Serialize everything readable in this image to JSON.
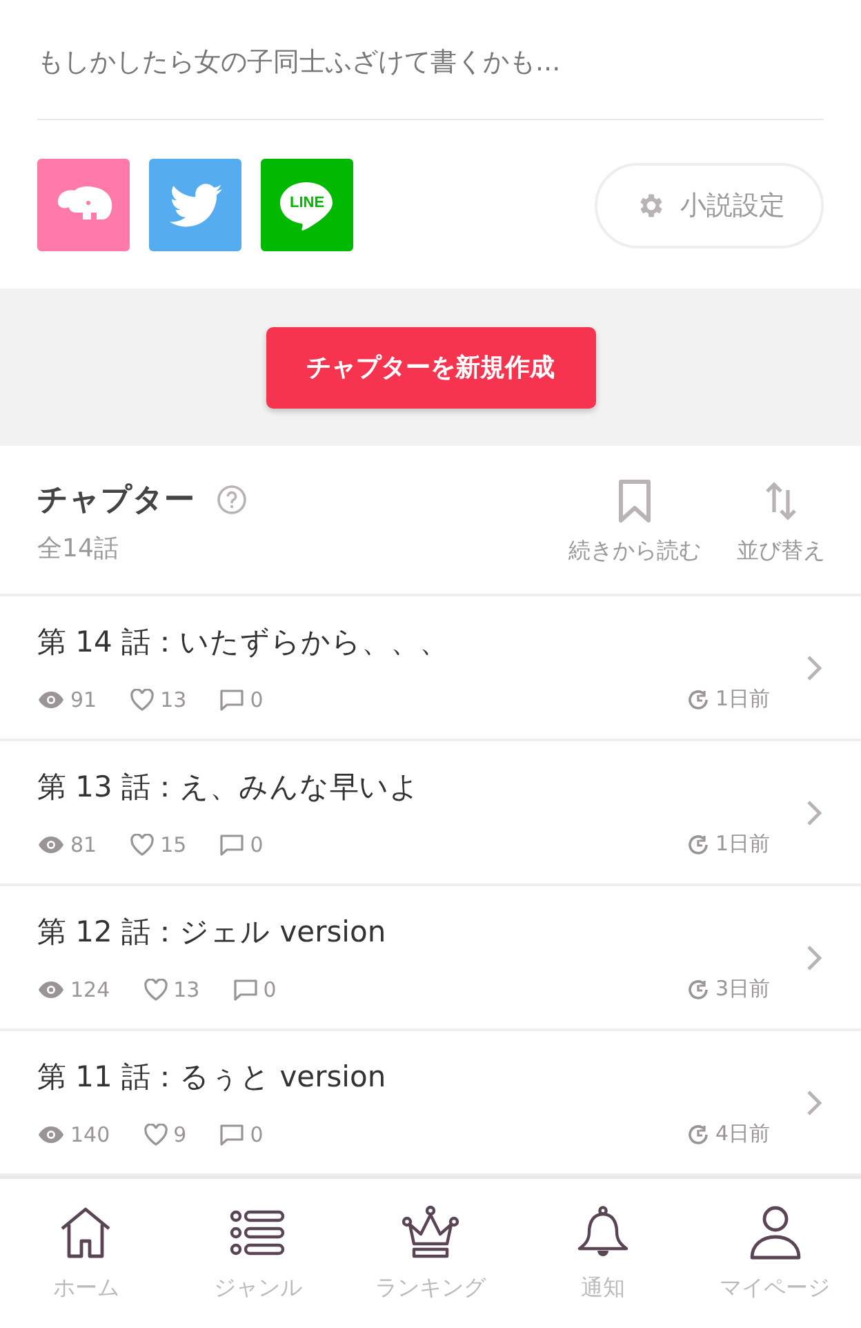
{
  "description": "もしかしたら女の子同士ふざけて書くかも...",
  "share_buttons": [
    {
      "kind": "elephant"
    },
    {
      "kind": "twitter"
    },
    {
      "kind": "line",
      "label": "LINE"
    }
  ],
  "settings_button": {
    "label": "小説設定"
  },
  "create_button": {
    "label": "チャプターを新規作成"
  },
  "chapters_header": {
    "title": "チャプター",
    "count": "全14話",
    "actions": [
      {
        "kind": "bookmark",
        "label": "続きから読む"
      },
      {
        "kind": "sort",
        "label": "並び替え"
      }
    ]
  },
  "chapters": [
    {
      "title": "第 14 話：いたずらから、、、",
      "views": "91",
      "likes": "13",
      "comments": "0",
      "updated": "1日前"
    },
    {
      "title": "第 13 話：え、みんな早いよ",
      "views": "81",
      "likes": "15",
      "comments": "0",
      "updated": "1日前"
    },
    {
      "title": "第 12 話：ジェル version",
      "views": "124",
      "likes": "13",
      "comments": "0",
      "updated": "3日前"
    },
    {
      "title": "第 11 話：るぅと version",
      "views": "140",
      "likes": "9",
      "comments": "0",
      "updated": "4日前"
    }
  ],
  "bottom_nav": [
    {
      "kind": "home",
      "label": "ホーム",
      "selected": false
    },
    {
      "kind": "genre",
      "label": "ジャンル",
      "selected": false
    },
    {
      "kind": "ranking",
      "label": "ランキング",
      "selected": false
    },
    {
      "kind": "notice",
      "label": "通知",
      "selected": false
    },
    {
      "kind": "mypage",
      "label": "マイページ",
      "selected": false
    }
  ]
}
